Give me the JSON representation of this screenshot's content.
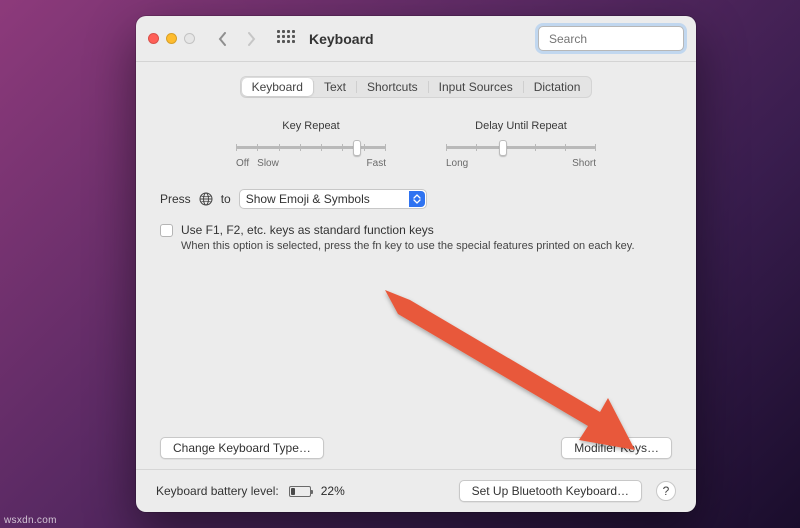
{
  "titlebar": {
    "title": "Keyboard",
    "search_placeholder": "Search"
  },
  "tabs": [
    {
      "label": "Keyboard",
      "active": true
    },
    {
      "label": "Text"
    },
    {
      "label": "Shortcuts"
    },
    {
      "label": "Input Sources"
    },
    {
      "label": "Dictation"
    }
  ],
  "sliders": {
    "key_repeat": {
      "label": "Key Repeat",
      "end_left": "Off",
      "end_mid": "Slow",
      "end_right": "Fast",
      "thumb_pct": 78
    },
    "delay_until_repeat": {
      "label": "Delay Until Repeat",
      "end_left": "Long",
      "end_right": "Short",
      "thumb_pct": 35
    }
  },
  "press_row": {
    "prefix": "Press",
    "suffix": "to",
    "select_value": "Show Emoji & Symbols"
  },
  "fn_checkbox": {
    "label": "Use F1, F2, etc. keys as standard function keys",
    "desc": "When this option is selected, press the fn key to use the special features printed on each key."
  },
  "buttons": {
    "change_type": "Change Keyboard Type…",
    "modifier_keys": "Modifier Keys…",
    "setup_bluetooth": "Set Up Bluetooth Keyboard…"
  },
  "footer": {
    "battery_label": "Keyboard battery level:",
    "battery_pct": "22%"
  },
  "help_label": "?",
  "watermark": "wsxdn.com"
}
